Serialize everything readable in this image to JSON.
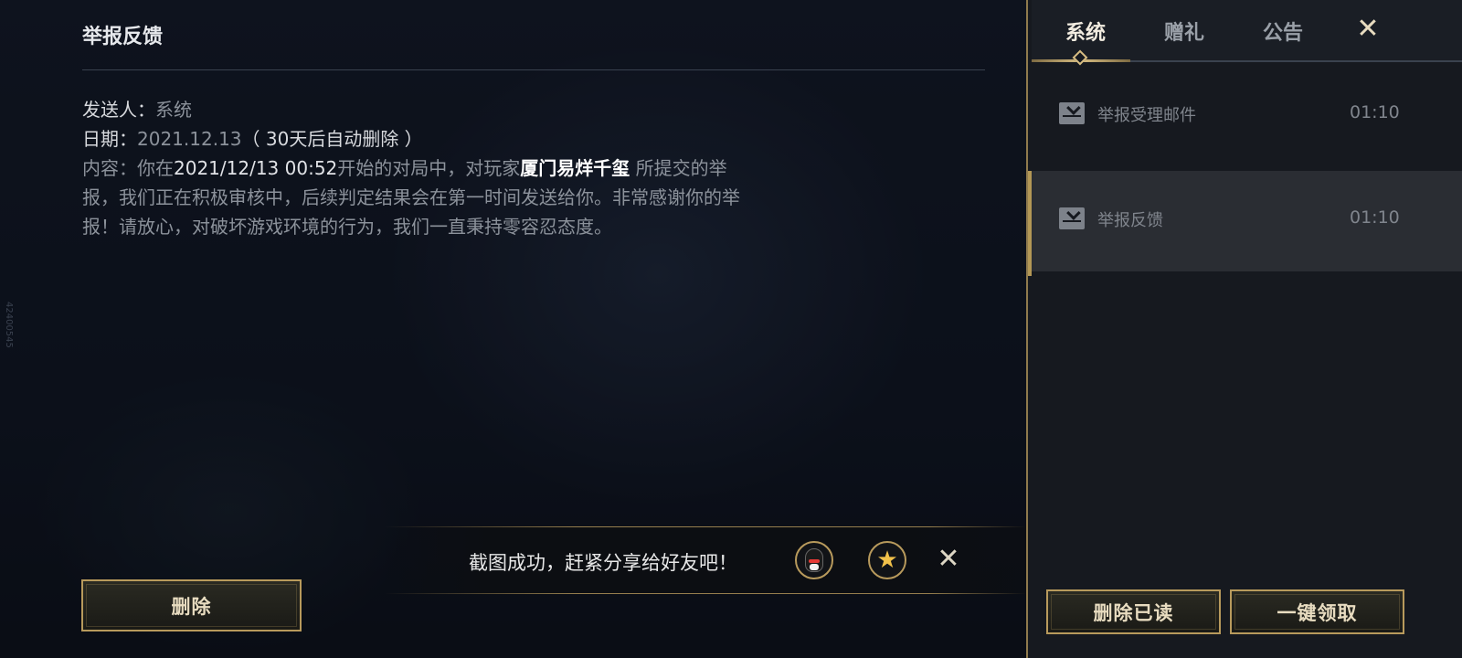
{
  "mail": {
    "title": "举报反馈",
    "sender_key": "发送人：",
    "sender_value": "系统",
    "date_key": "日期：",
    "date_value": "2021.12.13",
    "date_note": "（ 30天后自动删除 ）",
    "body": {
      "p1": "内容：你在",
      "time": "2021/12/13 00:52",
      "p2": "开始的对局中，对玩家",
      "player": "厦门易烊千玺",
      "p3": "  所提交的举报，我们正在积极审核中，后续判定结果会在第一时间发送给你。非常感谢你的举报！请放心，对破坏游戏环境的行为，我们一直秉持零容忍态度。"
    },
    "delete_label": "删除"
  },
  "toast": {
    "text": "截图成功，赶紧分享给好友吧！",
    "qq_icon": "qq-penguin-icon",
    "star_icon": "star-icon",
    "close_glyph": "✕"
  },
  "edge_mark": "42400545",
  "panel": {
    "tabs": [
      {
        "label": "系统",
        "active": true
      },
      {
        "label": "赠礼",
        "active": false
      },
      {
        "label": "公告",
        "active": false
      }
    ],
    "close_glyph": "✕",
    "items": [
      {
        "subject": "举报受理邮件",
        "time": "01:10",
        "icon": "mail-icon"
      },
      {
        "subject": "举报反馈",
        "time": "01:10",
        "icon": "mail-icon",
        "selected": true
      }
    ],
    "delete_read_label": "删除已读",
    "claim_all_label": "一键领取"
  },
  "colors": {
    "accent_gold": "#b89a5c",
    "panel_bg": "#16191f",
    "selected_row": "#2a2d33"
  }
}
